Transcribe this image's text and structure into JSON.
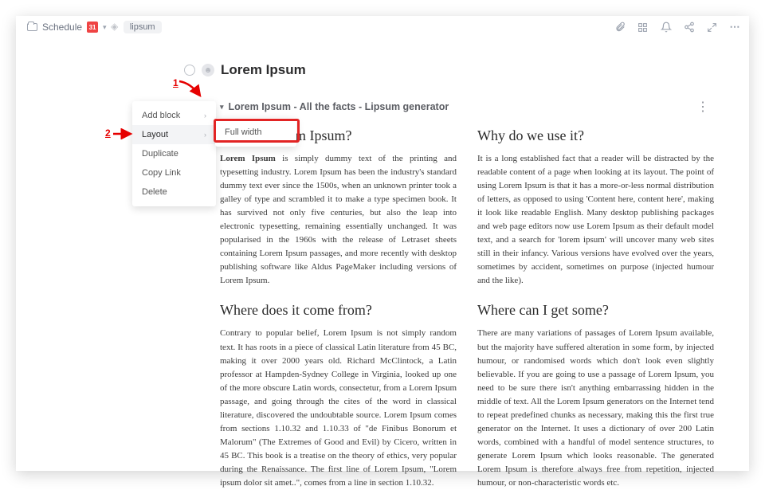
{
  "topbar": {
    "folder_label": "Schedule",
    "tag_label": "lipsum"
  },
  "title": "Lorem Ipsum",
  "block": {
    "header": "Lorem Ipsum - All the facts - Lipsum generator"
  },
  "context_menu": {
    "items": [
      {
        "label": "Add block",
        "has_sub": true
      },
      {
        "label": "Layout",
        "has_sub": true
      },
      {
        "label": "Duplicate",
        "has_sub": false
      },
      {
        "label": "Copy Link",
        "has_sub": false
      },
      {
        "label": "Delete",
        "has_sub": false
      }
    ]
  },
  "submenu": {
    "item": "Full width"
  },
  "annotations": {
    "n1": "1",
    "n2": "2"
  },
  "columns": {
    "left": {
      "h1": "What is Lorem Ipsum?",
      "p1_lead": "Lorem Ipsum",
      "p1_rest": " is simply dummy text of the printing and typesetting industry. Lorem Ipsum has been the industry's standard dummy text ever since the 1500s, when an unknown printer took a galley of type and scrambled it to make a type specimen book. It has survived not only five centuries, but also the leap into electronic typesetting, remaining essentially unchanged. It was popularised in the 1960s with the release of Letraset sheets containing Lorem Ipsum passages, and more recently with desktop publishing software like Aldus PageMaker including versions of Lorem Ipsum.",
      "h2": "Where does it come from?",
      "p2": "Contrary to popular belief, Lorem Ipsum is not simply random text. It has roots in a piece of classical Latin literature from 45 BC, making it over 2000 years old. Richard McClintock, a Latin professor at Hampden-Sydney College in Virginia, looked up one of the more obscure Latin words, consectetur, from a Lorem Ipsum passage, and going through the cites of the word in classical literature, discovered the undoubtable source. Lorem Ipsum comes from sections 1.10.32 and 1.10.33 of \"de Finibus Bonorum et Malorum\" (The Extremes of Good and Evil) by Cicero, written in 45 BC. This book is a treatise on the theory of ethics, very popular during the Renaissance. The first line of Lorem Ipsum, \"Lorem ipsum dolor sit amet..\", comes from a line in section 1.10.32."
    },
    "right": {
      "h1": "Why do we use it?",
      "p1": "It is a long established fact that a reader will be distracted by the readable content of a page when looking at its layout. The point of using Lorem Ipsum is that it has a more-or-less normal distribution of letters, as opposed to using 'Content here, content here', making it look like readable English. Many desktop publishing packages and web page editors now use Lorem Ipsum as their default model text, and a search for 'lorem ipsum' will uncover many web sites still in their infancy. Various versions have evolved over the years, sometimes by accident, sometimes on purpose (injected humour and the like).",
      "h2": "Where can I get some?",
      "p2": "There are many variations of passages of Lorem Ipsum available, but the majority have suffered alteration in some form, by injected humour, or randomised words which don't look even slightly believable. If you are going to use a passage of Lorem Ipsum, you need to be sure there isn't anything embarrassing hidden in the middle of text. All the Lorem Ipsum generators on the Internet tend to repeat predefined chunks as necessary, making this the first true generator on the Internet. It uses a dictionary of over 200 Latin words, combined with a handful of model sentence structures, to generate Lorem Ipsum which looks reasonable. The generated Lorem Ipsum is therefore always free from repetition, injected humour, or non-characteristic words etc."
    }
  }
}
